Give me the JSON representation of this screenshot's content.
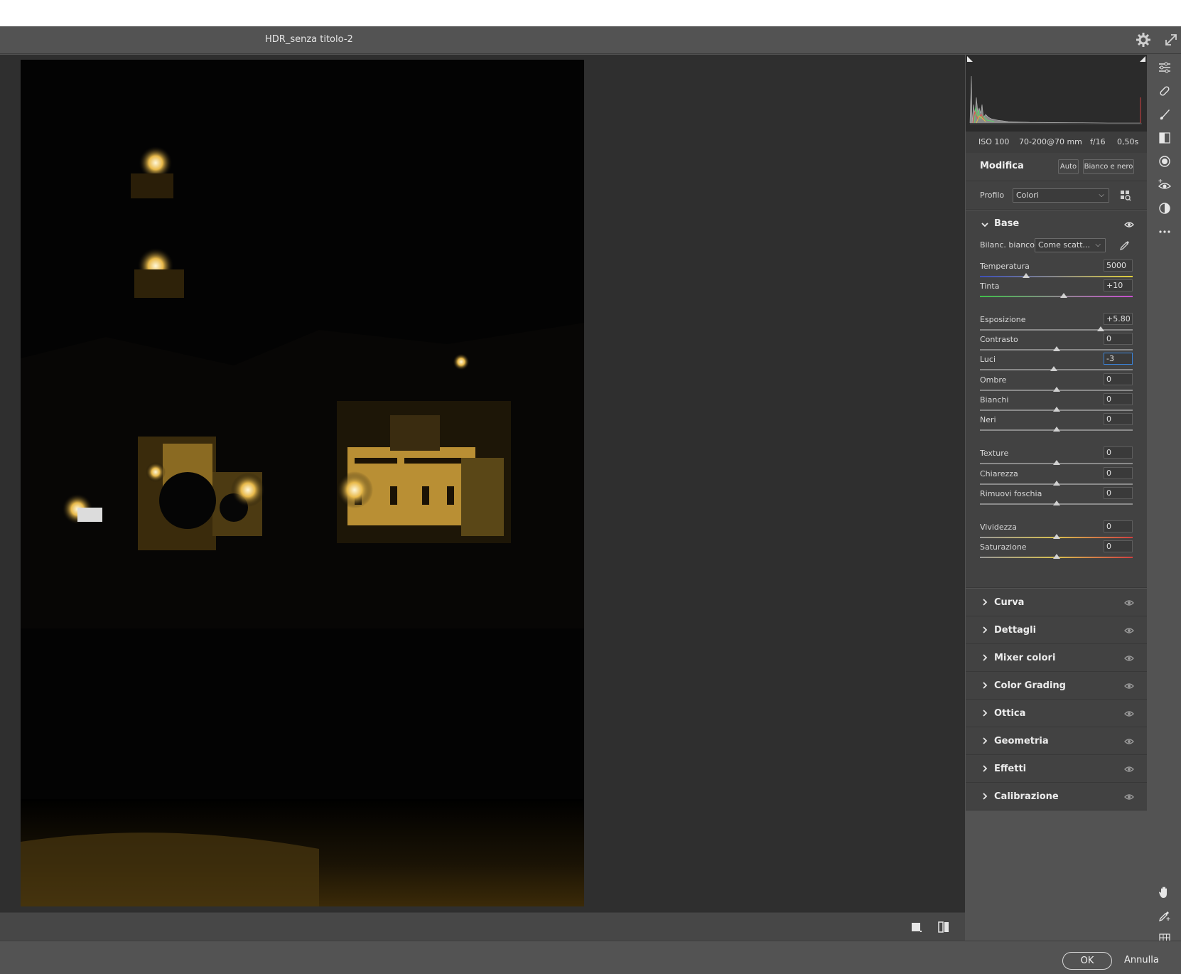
{
  "window": {
    "title": "HDR_senza titolo-2"
  },
  "metadata": {
    "iso": "ISO 100",
    "lens": "70-200@70 mm",
    "aperture": "f/16",
    "shutter": "0,50s"
  },
  "edit": {
    "title": "Modifica",
    "auto_label": "Auto",
    "bw_label": "Bianco e nero",
    "profile_label": "Profilo",
    "profile_value": "Colori"
  },
  "base": {
    "title": "Base",
    "wb_label": "Bilanc. bianco",
    "wb_value": "Come scatt...",
    "sliders": [
      {
        "label": "Temperatura",
        "value": "5000",
        "position": 0.3
      },
      {
        "label": "Tinta",
        "value": "+10",
        "position": 0.55
      },
      {
        "label": "Esposizione",
        "value": "+5.80",
        "position": 0.79
      },
      {
        "label": "Contrasto",
        "value": "0",
        "position": 0.5
      },
      {
        "label": "Luci",
        "value": "-3",
        "position": 0.485
      },
      {
        "label": "Ombre",
        "value": "0",
        "position": 0.5
      },
      {
        "label": "Bianchi",
        "value": "0",
        "position": 0.5
      },
      {
        "label": "Neri",
        "value": "0",
        "position": 0.5
      },
      {
        "label": "Texture",
        "value": "0",
        "position": 0.5
      },
      {
        "label": "Chiarezza",
        "value": "0",
        "position": 0.5
      },
      {
        "label": "Rimuovi foschia",
        "value": "0",
        "position": 0.5
      },
      {
        "label": "Vividezza",
        "value": "0",
        "position": 0.5
      },
      {
        "label": "Saturazione",
        "value": "0",
        "position": 0.5
      }
    ]
  },
  "sections": [
    "Curva",
    "Dettagli",
    "Mixer colori",
    "Color Grading",
    "Ottica",
    "Geometria",
    "Effetti",
    "Calibrazione"
  ],
  "footer": {
    "ok_label": "OK",
    "cancel_label": "Annulla"
  },
  "colors": {
    "panel_bg": "#424242",
    "app_bg": "#535353",
    "canvas_bg": "#2f2f2f",
    "accent": "#3b82d6"
  }
}
